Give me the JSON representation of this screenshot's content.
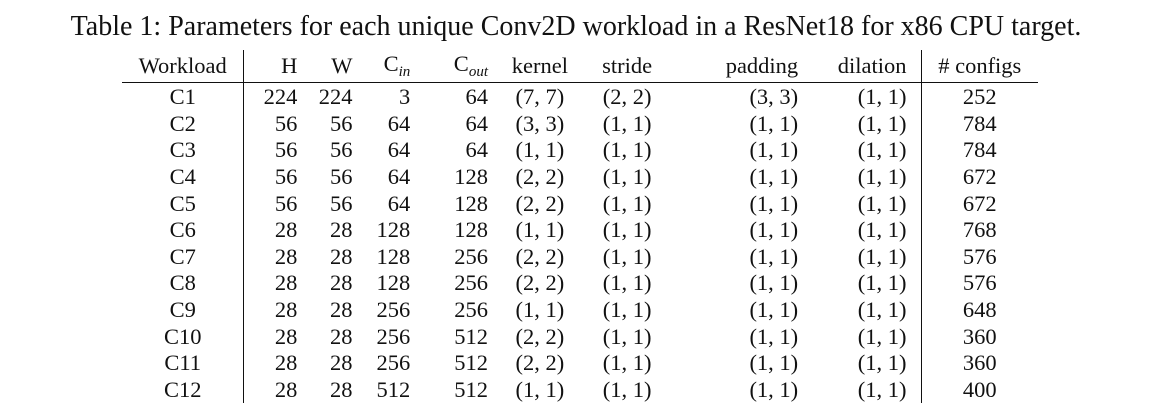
{
  "caption": "Table 1: Parameters for each unique Conv2D workload in a ResNet18 for x86 CPU target.",
  "headers": {
    "workload": "Workload",
    "h": "H",
    "w": "W",
    "cin_base": "C",
    "cin_sub": "in",
    "cout_base": "C",
    "cout_sub": "out",
    "kernel": "kernel",
    "stride": "stride",
    "padding": "padding",
    "dilation": "dilation",
    "configs": "# configs"
  },
  "rows": [
    {
      "workload": "C1",
      "h": "224",
      "w": "224",
      "cin": "3",
      "cout": "64",
      "kernel": "(7, 7)",
      "stride": "(2, 2)",
      "padding": "(3, 3)",
      "dilation": "(1, 1)",
      "configs": "252"
    },
    {
      "workload": "C2",
      "h": "56",
      "w": "56",
      "cin": "64",
      "cout": "64",
      "kernel": "(3, 3)",
      "stride": "(1, 1)",
      "padding": "(1, 1)",
      "dilation": "(1, 1)",
      "configs": "784"
    },
    {
      "workload": "C3",
      "h": "56",
      "w": "56",
      "cin": "64",
      "cout": "64",
      "kernel": "(1, 1)",
      "stride": "(1, 1)",
      "padding": "(1, 1)",
      "dilation": "(1, 1)",
      "configs": "784"
    },
    {
      "workload": "C4",
      "h": "56",
      "w": "56",
      "cin": "64",
      "cout": "128",
      "kernel": "(2, 2)",
      "stride": "(1, 1)",
      "padding": "(1, 1)",
      "dilation": "(1, 1)",
      "configs": "672"
    },
    {
      "workload": "C5",
      "h": "56",
      "w": "56",
      "cin": "64",
      "cout": "128",
      "kernel": "(2, 2)",
      "stride": "(1, 1)",
      "padding": "(1, 1)",
      "dilation": "(1, 1)",
      "configs": "672"
    },
    {
      "workload": "C6",
      "h": "28",
      "w": "28",
      "cin": "128",
      "cout": "128",
      "kernel": "(1, 1)",
      "stride": "(1, 1)",
      "padding": "(1, 1)",
      "dilation": "(1, 1)",
      "configs": "768"
    },
    {
      "workload": "C7",
      "h": "28",
      "w": "28",
      "cin": "128",
      "cout": "256",
      "kernel": "(2, 2)",
      "stride": "(1, 1)",
      "padding": "(1, 1)",
      "dilation": "(1, 1)",
      "configs": "576"
    },
    {
      "workload": "C8",
      "h": "28",
      "w": "28",
      "cin": "128",
      "cout": "256",
      "kernel": "(2, 2)",
      "stride": "(1, 1)",
      "padding": "(1, 1)",
      "dilation": "(1, 1)",
      "configs": "576"
    },
    {
      "workload": "C9",
      "h": "28",
      "w": "28",
      "cin": "256",
      "cout": "256",
      "kernel": "(1, 1)",
      "stride": "(1, 1)",
      "padding": "(1, 1)",
      "dilation": "(1, 1)",
      "configs": "648"
    },
    {
      "workload": "C10",
      "h": "28",
      "w": "28",
      "cin": "256",
      "cout": "512",
      "kernel": "(2, 2)",
      "stride": "(1, 1)",
      "padding": "(1, 1)",
      "dilation": "(1, 1)",
      "configs": "360"
    },
    {
      "workload": "C11",
      "h": "28",
      "w": "28",
      "cin": "256",
      "cout": "512",
      "kernel": "(2, 2)",
      "stride": "(1, 1)",
      "padding": "(1, 1)",
      "dilation": "(1, 1)",
      "configs": "360"
    },
    {
      "workload": "C12",
      "h": "28",
      "w": "28",
      "cin": "512",
      "cout": "512",
      "kernel": "(1, 1)",
      "stride": "(1, 1)",
      "padding": "(1, 1)",
      "dilation": "(1, 1)",
      "configs": "400"
    }
  ]
}
